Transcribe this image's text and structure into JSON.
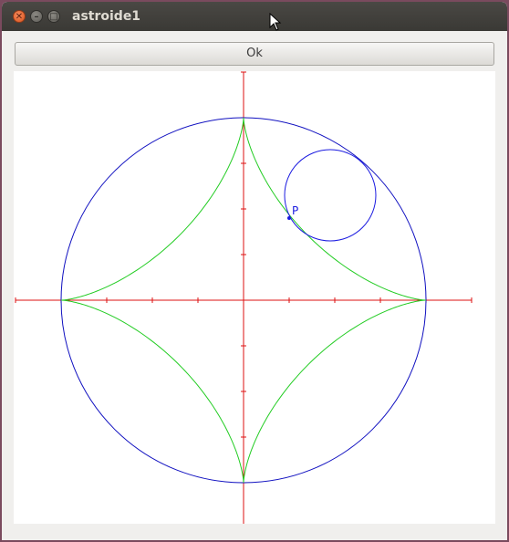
{
  "window": {
    "title": "astroide1",
    "controls": {
      "close_glyph": "✕",
      "minimize_glyph": "–",
      "maximize_glyph": "□"
    }
  },
  "toolbar": {
    "ok_label": "Ok"
  },
  "canvas": {
    "point_label": "P",
    "colors": {
      "axes": "#dd1111",
      "outer_circle": "#1010c0",
      "rolling_circle": "#1a1ae0",
      "astroid": "#22cc22",
      "point": "#1a1ae0"
    }
  },
  "chart_data": {
    "type": "line",
    "title": "",
    "xlabel": "",
    "ylabel": "",
    "xlim": [
      -5,
      5
    ],
    "ylim": [
      -5,
      5
    ],
    "grid": false,
    "outer_circle": {
      "center": [
        0,
        0
      ],
      "radius": 4
    },
    "rolling_circle": {
      "center": [
        1.9,
        2.3
      ],
      "radius": 1
    },
    "astroid": {
      "a": 4
    },
    "point_P": [
      1.0,
      1.8
    ]
  }
}
